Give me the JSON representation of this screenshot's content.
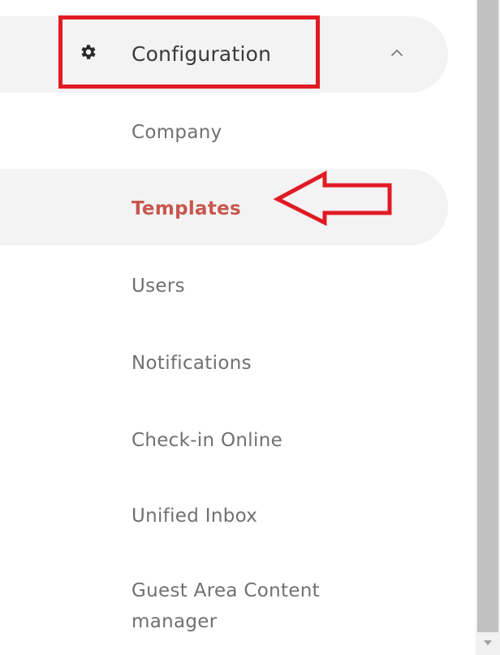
{
  "sidebar": {
    "section": {
      "label": "Configuration",
      "icon": "gear-icon",
      "toggle_icon": "chevron-up-icon",
      "expanded": true
    },
    "items": [
      {
        "label": "Company",
        "active": false
      },
      {
        "label": "Templates",
        "active": true
      },
      {
        "label": "Users",
        "active": false
      },
      {
        "label": "Notifications",
        "active": false
      },
      {
        "label": "Check-in Online",
        "active": false
      },
      {
        "label": "Unified Inbox",
        "active": false
      },
      {
        "label": "Guest Area Content",
        "label_line2": "manager",
        "active": false
      }
    ]
  },
  "annotations": {
    "highlight_color": "#e01b24",
    "arrow_target": "Templates"
  },
  "colors": {
    "active_text": "#c8574d",
    "inactive_text": "#707070",
    "header_text": "#3a3a3a",
    "active_bg": "#f3f3f3"
  }
}
